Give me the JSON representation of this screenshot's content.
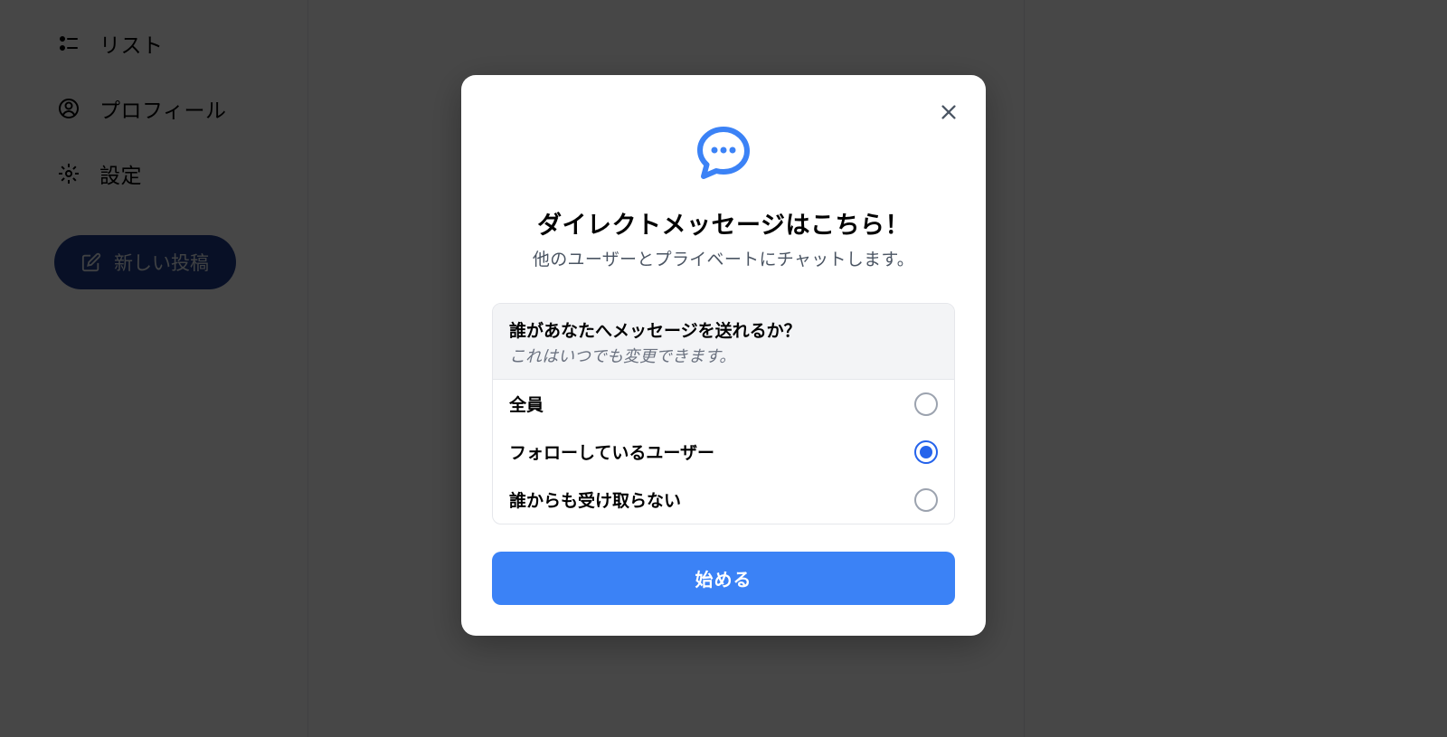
{
  "sidebar": {
    "items": [
      {
        "label": "リスト",
        "icon": "list"
      },
      {
        "label": "プロフィール",
        "icon": "profile"
      },
      {
        "label": "設定",
        "icon": "settings"
      }
    ],
    "newPostLabel": "新しい投稿"
  },
  "modal": {
    "title": "ダイレクトメッセージはこちら！",
    "subtitle": "他のユーザーとプライベートにチャットします。",
    "optionsHeader": {
      "title": "誰があなたへメッセージを送れるか？",
      "subtitle": "これはいつでも変更できます。"
    },
    "options": [
      {
        "label": "全員",
        "selected": false
      },
      {
        "label": "フォローしているユーザー",
        "selected": true
      },
      {
        "label": "誰からも受け取らない",
        "selected": false
      }
    ],
    "startButton": "始める"
  },
  "colors": {
    "primary": "#3b82f6",
    "primaryDark": "#1e3a8a"
  }
}
